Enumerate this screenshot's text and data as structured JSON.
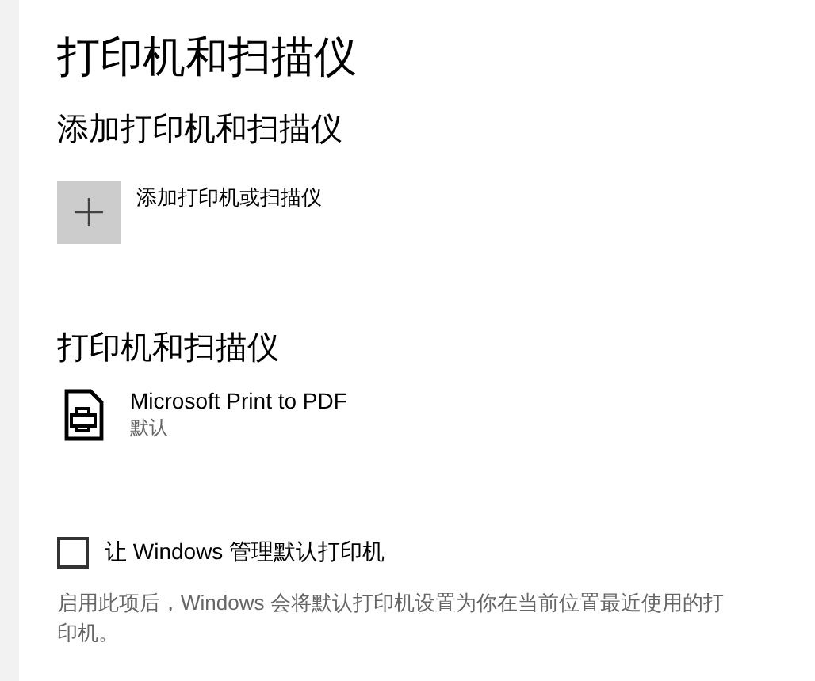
{
  "page": {
    "title": "打印机和扫描仪"
  },
  "add_section": {
    "heading": "添加打印机和扫描仪",
    "button_label": "添加打印机或扫描仪"
  },
  "printers_section": {
    "heading": "打印机和扫描仪",
    "printers": [
      {
        "name": "Microsoft Print to PDF",
        "status": "默认"
      }
    ]
  },
  "manage_default": {
    "label": "让 Windows 管理默认打印机",
    "checked": false,
    "description": "启用此项后，Windows 会将默认打印机设置为你在当前位置最近使用的打印机。"
  }
}
